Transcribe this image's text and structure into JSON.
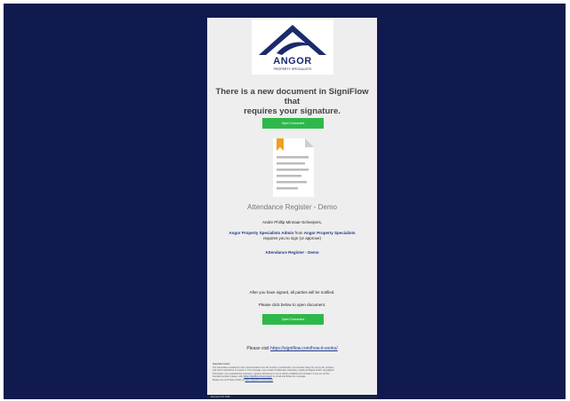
{
  "brand": {
    "name": "ANGOR",
    "tagline": "PROPERTY SPECIALISTS",
    "primary_color": "#1b2a6b",
    "button_color": "#2eb84b",
    "frame_color": "#101a4e"
  },
  "email": {
    "headline_line1": "There is a new document in SigniFlow that",
    "headline_line2": "requires your signature.",
    "open_button_label": "Open Document",
    "document_icon": "document-icon",
    "document_title": "Attendance Register - Demo",
    "recipient_greeting": "Andre Phillip Minnaar-Scheepers,",
    "sender": "Angor Property Specialists Admin",
    "from_word": " from ",
    "sender_org": "Angor Property Specialists",
    "request_text": "requires you to sign (or approve)",
    "document_link": "Attendance Register - Demo",
    "notify_text": "After you have signed, all parties will be notified.",
    "click_text": "Please click below to open document.",
    "open_button_label_2": "Open Document",
    "visit_prefix": "Please visit ",
    "visit_url": "https://signiflow.com/how-it-works/"
  },
  "disclaimer": {
    "heading": "Important notice",
    "line1": "The information contained in this communication from the sender is confidential. It is intended solely for use by the recipient",
    "line2": "and others authorized to receive it. This message may contain confidential, proprietary, legally privileged and/or copyrighted",
    "line3": "information. Any unauthorized reviewing, copying, disclosure or use is strictly prohibited and unlawful. If you are not the",
    "line4_prefix": "intended recipient please notify ",
    "line4_link": "https://signiflow.com/contact/",
    "line4_suffix": " by email and delete the message.",
    "line5_prefix": "Please see our Privacy Policy at ",
    "line5_link": "https://signiflow.com/privacy/"
  },
  "footer": {
    "document_id": "Document ID: 9145"
  }
}
